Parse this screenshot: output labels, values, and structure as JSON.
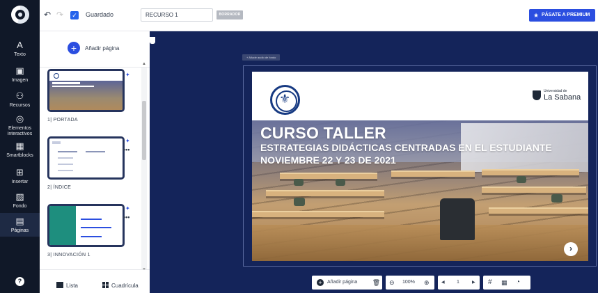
{
  "app": {
    "logo_icon": "genially-logo-icon"
  },
  "rail": {
    "items": [
      {
        "label": "Texto",
        "icon": "text-icon",
        "glyph": "A"
      },
      {
        "label": "Imagen",
        "icon": "image-icon",
        "glyph": "▣"
      },
      {
        "label": "Recursos",
        "icon": "resources-icon",
        "glyph": "⚇"
      },
      {
        "label": "Elementos interactivos",
        "icon": "interactive-icon",
        "glyph": "◎"
      },
      {
        "label": "Smartblocks",
        "icon": "smartblocks-icon",
        "glyph": "▦"
      },
      {
        "label": "Insertar",
        "icon": "insert-icon",
        "glyph": "⊞"
      },
      {
        "label": "Fondo",
        "icon": "background-icon",
        "glyph": "▨"
      },
      {
        "label": "Páginas",
        "icon": "pages-icon",
        "glyph": "▤"
      }
    ],
    "help_glyph": "?"
  },
  "topbar": {
    "undo_glyph": "↶",
    "redo_glyph": "↷",
    "saved_label": "Guardado",
    "title_value": "RECURSO 1",
    "draft_label": "BORRADOR",
    "premium_label": "PÁSATE A PREMIUM",
    "premium_star": "★"
  },
  "panel": {
    "add_page_label": "Añadir página",
    "pages": [
      {
        "number": "1",
        "title": "PORTADA"
      },
      {
        "number": "2",
        "title": "ÍNDICE"
      },
      {
        "number": "3",
        "title": "INNOVACIÓN 1"
      }
    ],
    "dots": "•••",
    "view_list_label": "Lista",
    "view_grid_label": "Cuadrícula"
  },
  "canvas": {
    "audio_label": "+ Añade audio de fondo",
    "slide": {
      "title": "CURSO TALLER",
      "subtitle": "ESTRATEGIAS DIDÁCTICAS CENTRADAS EN EL ESTUDIANTE",
      "date": "NOVIEMBRE 22 Y 23 DE 2021",
      "logo_small": "Universidad de",
      "logo_big": "La Sabana"
    },
    "next_glyph": "›"
  },
  "bottom_toolbar": {
    "add_page_label": "Añadir página",
    "zoom_value": "100%",
    "current_page": "1"
  },
  "colors": {
    "rail_bg": "#101828",
    "accent": "#2b4ee0",
    "canvas_bg": "#14245a",
    "thumb_border": "#26345d"
  }
}
